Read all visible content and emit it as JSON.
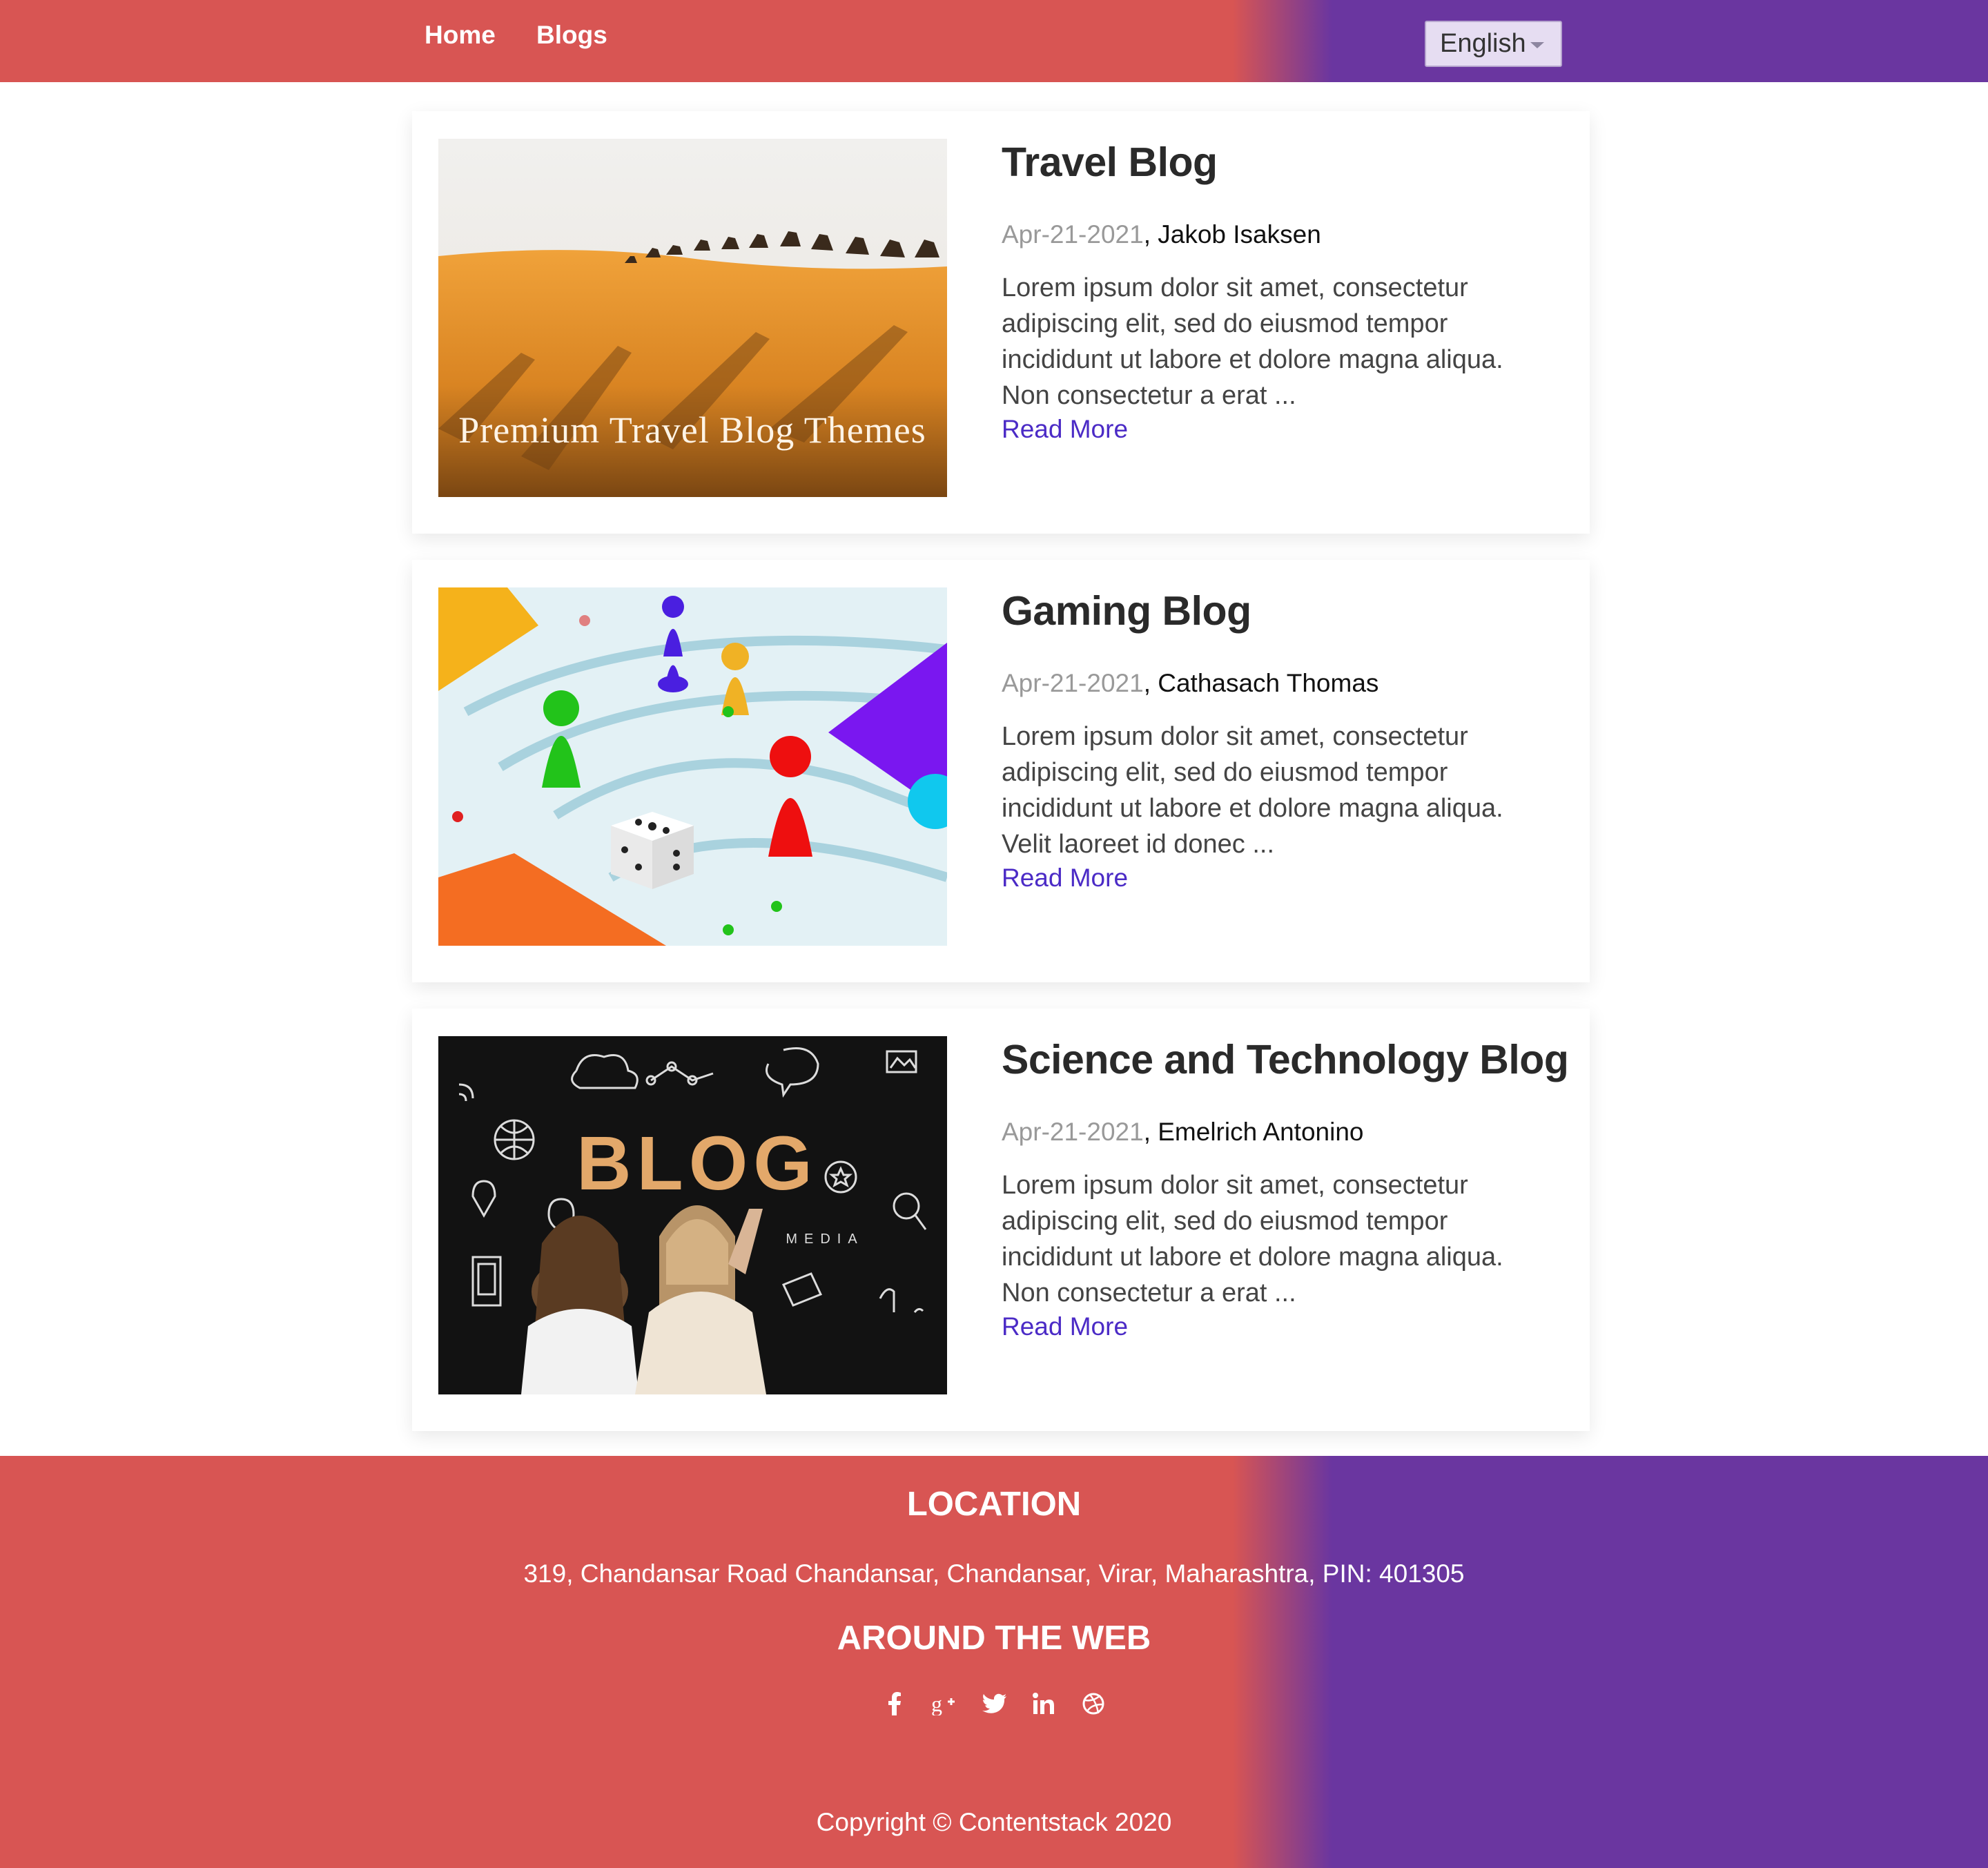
{
  "header": {
    "nav": [
      {
        "label": "Home"
      },
      {
        "label": "Blogs"
      }
    ],
    "language": {
      "selected": "English"
    },
    "gradient_colors": [
      "#d85553",
      "#6a36a0"
    ]
  },
  "posts": [
    {
      "title": "Travel Blog",
      "date": "Apr-21-2021",
      "author": "Jakob Isaksen",
      "excerpt": "Lorem ipsum dolor sit amet, consectetur adipiscing elit, sed do eiusmod tempor incididunt ut labore et dolore magna aliqua. Non consectetur a erat ...",
      "read_more": "Read More",
      "image_caption": "Premium Travel Blog Themes"
    },
    {
      "title": "Gaming Blog",
      "date": "Apr-21-2021",
      "author": "Cathasach Thomas",
      "excerpt": "Lorem ipsum dolor sit amet, consectetur adipiscing elit, sed do eiusmod tempor incididunt ut labore et dolore magna aliqua. Velit laoreet id donec ...",
      "read_more": "Read More"
    },
    {
      "title": "Science and Technology Blog",
      "date": "Apr-21-2021",
      "author": "Emelrich Antonino",
      "excerpt": "Lorem ipsum dolor sit amet, consectetur adipiscing elit, sed do eiusmod tempor incididunt ut labore et dolore magna aliqua. Non consectetur a erat ...",
      "read_more": "Read More",
      "image_text": "BLOG",
      "image_subtext": "MEDIA"
    }
  ],
  "footer": {
    "location_heading": "LOCATION",
    "address": "319, Chandansar Road Chandansar, Chandansar, Virar, Maharashtra, PIN: 401305",
    "web_heading": "AROUND THE WEB",
    "social_icons": [
      "facebook-icon",
      "google-plus-icon",
      "twitter-icon",
      "linkedin-icon",
      "dribbble-icon"
    ],
    "copyright": "Copyright © Contentstack 2020"
  },
  "colors": {
    "link": "#4b2bc6",
    "accent_red": "#d85553",
    "accent_purple": "#6a36a0"
  }
}
